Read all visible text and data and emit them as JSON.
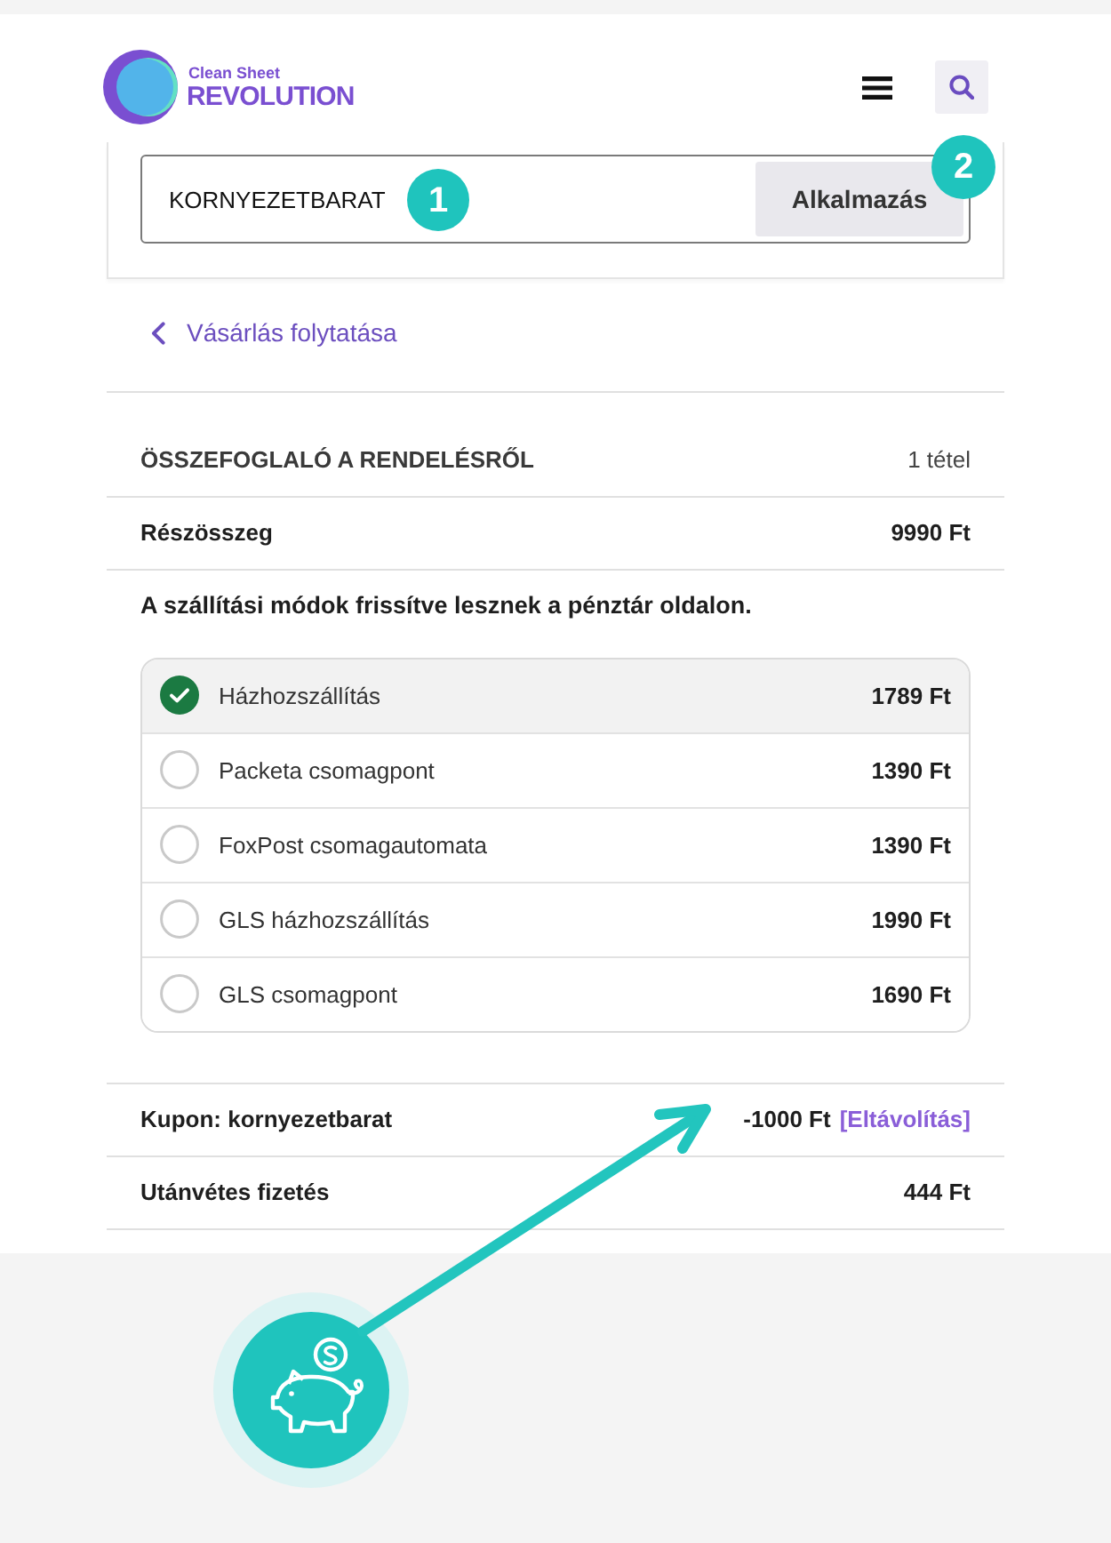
{
  "header": {
    "logo": {
      "line_1": "Clean Sheet",
      "line_2": "REVOLUTION"
    }
  },
  "coupon_form": {
    "value": "KORNYEZETBARAT",
    "button": "Alkalmazás"
  },
  "back_link": "Vásárlás folytatása",
  "order_summary": {
    "title": "ÖSSZEFOGLALÓ A RENDELÉSRŐL",
    "item_count": "1 tétel",
    "subtotal": {
      "label": "Részösszeg",
      "value": "9990 Ft"
    },
    "shipping_notice": "A szállítási módok frissítve lesznek a pénztár oldalon.",
    "shipping_options": [
      {
        "name": "Házhozszállítás",
        "price": "1789 Ft",
        "selected": true
      },
      {
        "name": "Packeta csomagpont",
        "price": "1390 Ft",
        "selected": false
      },
      {
        "name": "FoxPost csomagautomata",
        "price": "1390 Ft",
        "selected": false
      },
      {
        "name": "GLS házhozszállítás",
        "price": "1990 Ft",
        "selected": false
      },
      {
        "name": "GLS csomagpont",
        "price": "1690 Ft",
        "selected": false
      }
    ],
    "coupon": {
      "label": "Kupon: kornyezetbarat",
      "amount": "-1000 Ft",
      "remove_link": "[Eltávolítás]"
    },
    "cash_on_delivery": {
      "label": "Utánvétes fizetés",
      "value": "444 Ft"
    }
  },
  "annotations": {
    "step_markers": [
      "1",
      "2"
    ]
  }
}
